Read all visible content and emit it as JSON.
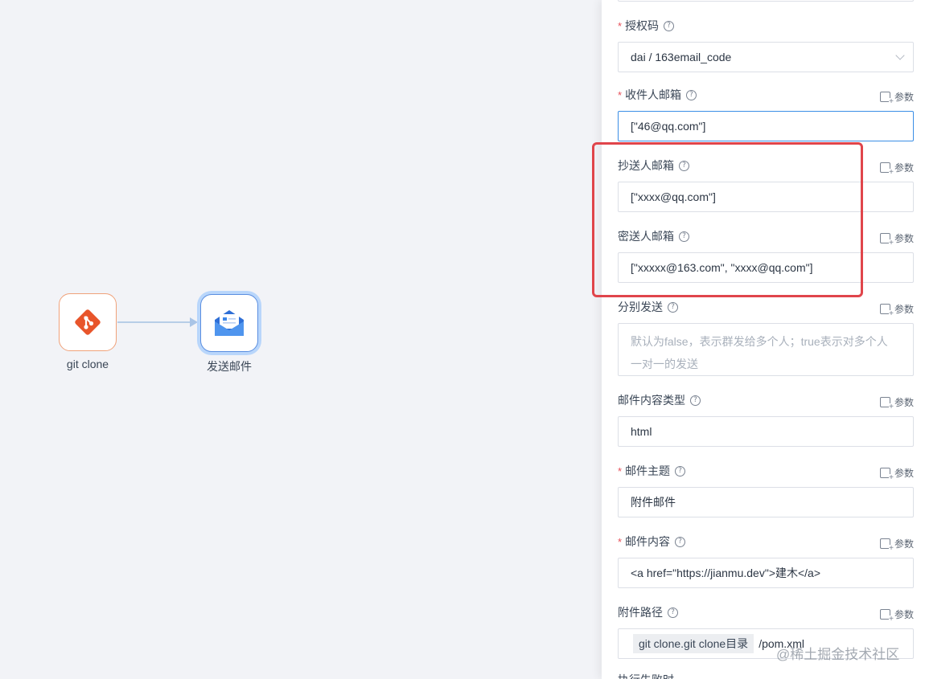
{
  "canvas": {
    "nodes": [
      {
        "label": "git clone",
        "icon": "git-icon",
        "color": "#e8552b"
      },
      {
        "label": "发送邮件",
        "icon": "mail-icon",
        "color": "#3c86e8"
      }
    ]
  },
  "param_label": "参数",
  "help_glyph": "?",
  "fields": {
    "auth_code": {
      "label": "授权码",
      "required": "*",
      "value": "dai / 163email_code"
    },
    "receiver": {
      "label": "收件人邮箱",
      "required": "*",
      "value": "[\"46@qq.com\"]"
    },
    "cc": {
      "label": "抄送人邮箱",
      "value": "[\"xxxx@qq.com\"]"
    },
    "bcc": {
      "label": "密送人邮箱",
      "value": "[\"xxxxx@163.com\", \"xxxx@qq.com\"]"
    },
    "separate": {
      "label": "分别发送",
      "placeholder_line1": "默认为false，表示群发给多个人；true表示对多个人",
      "placeholder_line2": "一对一的发送"
    },
    "content_type": {
      "label": "邮件内容类型",
      "value": "html"
    },
    "subject": {
      "label": "邮件主题",
      "required": "*",
      "value": "附件邮件"
    },
    "content": {
      "label": "邮件内容",
      "required": "*",
      "value": "<a href=\"https://jianmu.dev\">建木</a>"
    },
    "attachment": {
      "label": "附件路径",
      "tag": "git clone.git clone目录",
      "suffix": "/pom.xml"
    }
  },
  "bottom_partial_label": "执行失败时",
  "watermark": "@稀土掘金技术社区",
  "colors": {
    "accent": "#3a8ee6",
    "highlight": "#e0454b",
    "required": "#e7505a"
  }
}
